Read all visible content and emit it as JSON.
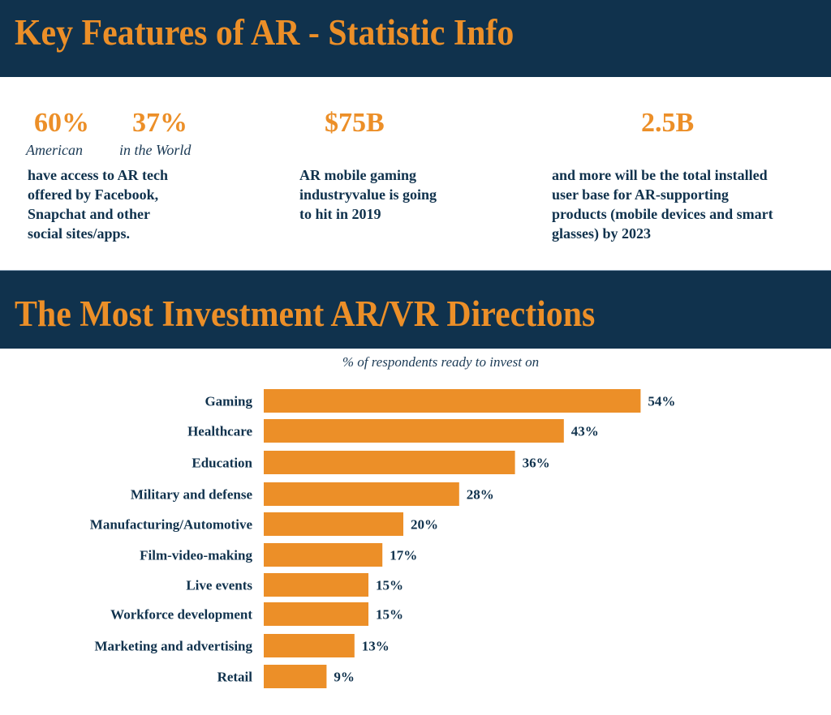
{
  "header": {
    "title": "Key Features of AR - Statistic Info"
  },
  "stats": {
    "access": {
      "items": [
        {
          "value": "60%",
          "label": "American"
        },
        {
          "value": "37%",
          "label": "in the World"
        }
      ],
      "description": [
        "have access to AR tech",
        "offered by Facebook,",
        "Snapchat and other",
        "social sites/apps."
      ]
    },
    "gaming": {
      "value": "$75B",
      "description": [
        "AR mobile gaming",
        "industryvalue is going",
        "to hit  in 2019"
      ]
    },
    "userbase": {
      "value": "2.5B",
      "description": [
        "and more will be the total installed",
        "user base for AR-supporting",
        "products (mobile devices and smart",
        "glasses)  by 2023"
      ]
    }
  },
  "section2": {
    "title": "The Most Investment  AR/VR Directions",
    "subtitle": "% of respondents ready to invest on"
  },
  "colors": {
    "navy": "#10324d",
    "orange": "#ec8f28"
  },
  "chart_data": {
    "type": "bar",
    "orientation": "horizontal",
    "title": "The Most Investment  AR/VR Directions",
    "subtitle": "% of respondents ready to invest on",
    "xlabel": "",
    "ylabel": "",
    "unit": "%",
    "grid": false,
    "legend": "none",
    "xlim": [
      0,
      54
    ],
    "categories": [
      "Gaming",
      "Healthcare",
      "Education",
      "Military and defense",
      "Manufacturing/Automotive",
      "Film-video-making",
      "Live events",
      "Workforce development",
      "Marketing and advertising",
      "Retail"
    ],
    "values": [
      54,
      43,
      36,
      28,
      20,
      17,
      15,
      15,
      13,
      9
    ],
    "data_labels": [
      "54%",
      "43%",
      "36%",
      "28%",
      "20%",
      "17%",
      "15%",
      "15%",
      "13%",
      "9%"
    ]
  }
}
